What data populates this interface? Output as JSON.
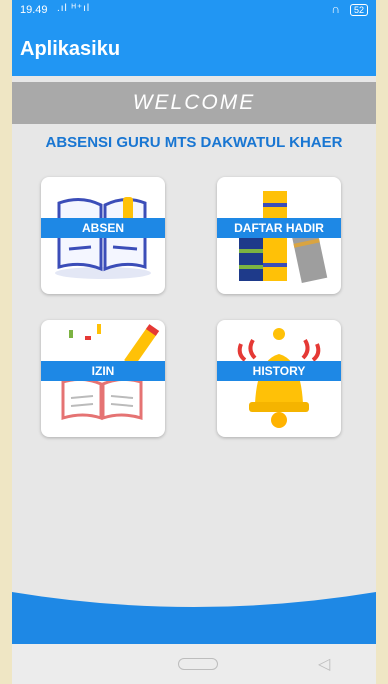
{
  "status": {
    "time": "19.49",
    "signal": ".ıl ᴴ⁺ıl",
    "battery": "52",
    "headset": "∩"
  },
  "app": {
    "title": "Aplikasiku"
  },
  "welcome": "WELCOME",
  "heading": "ABSENSI GURU  MTS DAKWATUL KHAER",
  "menu": {
    "absen": "ABSEN",
    "daftar_hadir": "DAFTAR HADIR",
    "izin": "IZIN",
    "history": "HISTORY"
  },
  "nav": {
    "back": "◁"
  },
  "colors": {
    "primary": "#2196f3",
    "band": "#1e88e5",
    "heading": "#1976d2"
  }
}
